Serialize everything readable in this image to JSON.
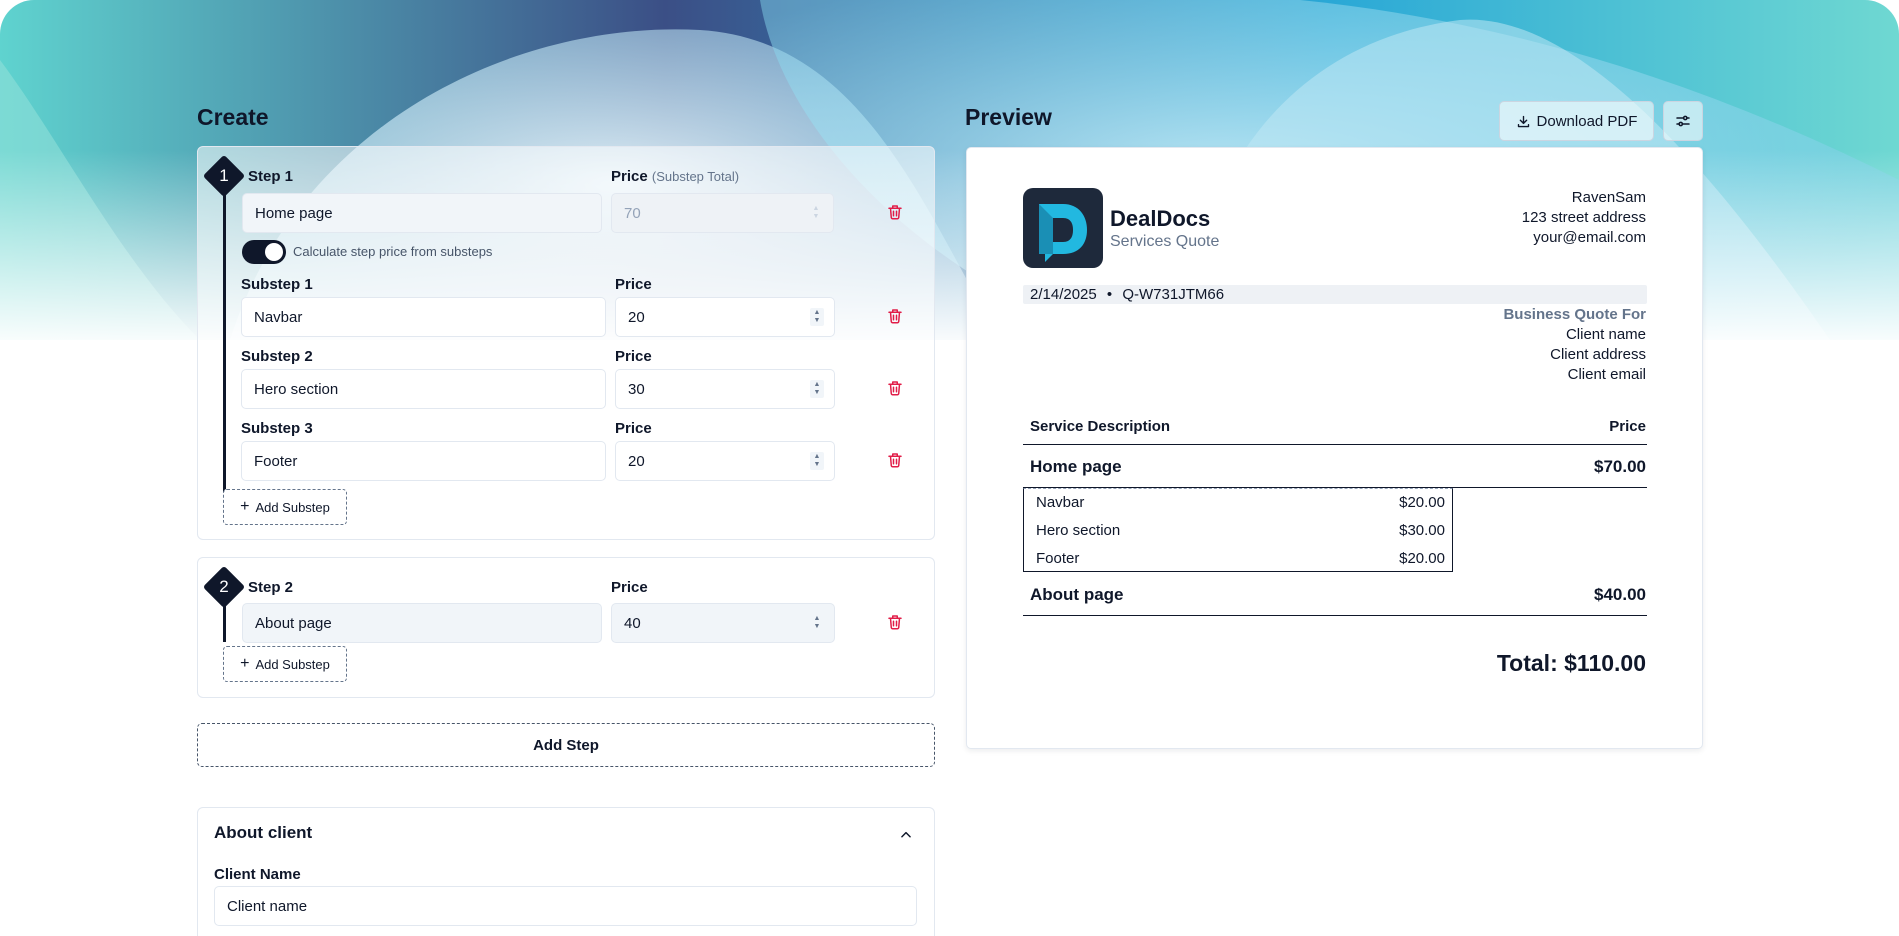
{
  "create": {
    "title": "Create",
    "steps": [
      {
        "number": "1",
        "label": "Step 1",
        "name": "Home page",
        "price_label": "Price",
        "price_sub_label": "(Substep Total)",
        "price": "70",
        "toggle_label": "Calculate step price from substeps",
        "toggle_on": true,
        "substeps": [
          {
            "label": "Substep 1",
            "name": "Navbar",
            "price_label": "Price",
            "price": "20"
          },
          {
            "label": "Substep 2",
            "name": "Hero section",
            "price_label": "Price",
            "price": "30"
          },
          {
            "label": "Substep 3",
            "name": "Footer",
            "price_label": "Price",
            "price": "20"
          }
        ],
        "add_substep": "Add Substep"
      },
      {
        "number": "2",
        "label": "Step 2",
        "name": "About page",
        "price_label": "Price",
        "price": "40",
        "add_substep": "Add Substep"
      }
    ],
    "add_step": "Add Step",
    "about_client": {
      "title": "About client",
      "client_name_label": "Client Name",
      "client_name_placeholder": "Client name"
    }
  },
  "preview": {
    "title": "Preview",
    "download_label": "Download PDF",
    "brand_name": "DealDocs",
    "brand_subtitle": "Services Quote",
    "sender": [
      "RavenSam",
      "123 street address",
      "your@email.com"
    ],
    "date": "2/14/2025",
    "separator": "•",
    "quote_id": "Q-W731JTM66",
    "quote_for_label": "Business Quote For",
    "client": [
      "Client name",
      "Client address",
      "Client email"
    ],
    "table": {
      "col_description": "Service Description",
      "col_price": "Price",
      "rows": [
        {
          "name": "Home page",
          "price": "$70.00",
          "subs": [
            {
              "name": "Navbar",
              "price": "$20.00"
            },
            {
              "name": "Hero section",
              "price": "$30.00"
            },
            {
              "name": "Footer",
              "price": "$20.00"
            }
          ]
        },
        {
          "name": "About page",
          "price": "$40.00",
          "subs": []
        }
      ]
    },
    "total": "Total: $110.00"
  },
  "colors": {
    "dark": "#0f172a",
    "danger": "#e11d48",
    "brand_logo_bg": "#1e293b",
    "brand_logo_accent": "#22b8e0"
  }
}
